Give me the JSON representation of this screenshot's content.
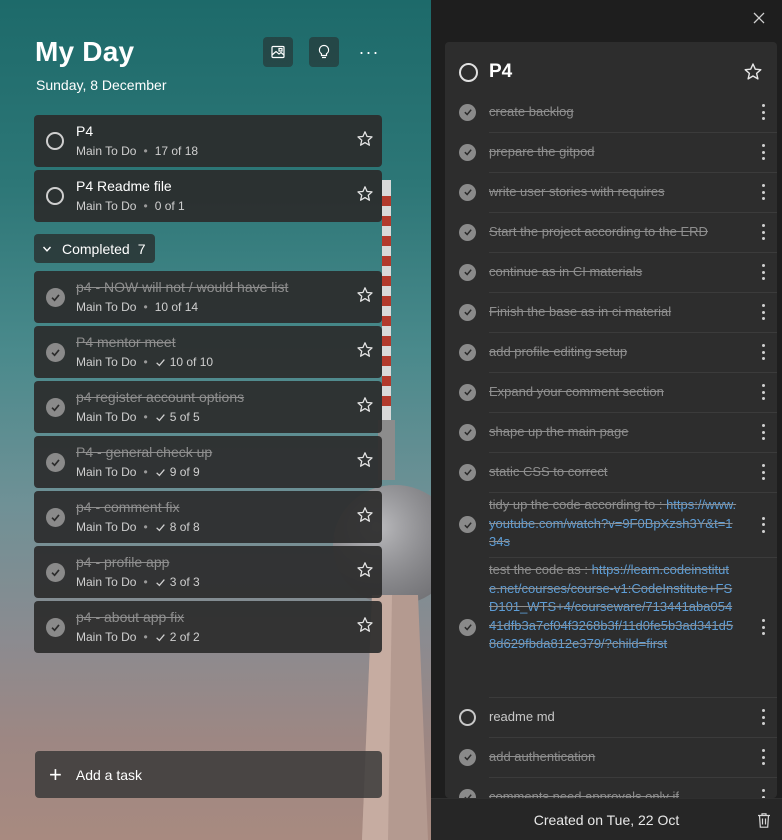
{
  "header": {
    "title": "My Day",
    "date": "Sunday, 8 December",
    "more_label": "···"
  },
  "tasks": [
    {
      "name": "P4",
      "list": "Main To Do",
      "steps": "17 of 18"
    },
    {
      "name": "P4 Readme file",
      "list": "Main To Do",
      "steps": "0 of 1"
    }
  ],
  "completed": {
    "label": "Completed",
    "count": "7",
    "items": [
      {
        "name": "p4 - NOW will not / would have list",
        "list": "Main To Do",
        "steps": "10 of 14"
      },
      {
        "name": "P4 mentor meet",
        "list": "Main To Do",
        "steps": "10 of 10"
      },
      {
        "name": "p4 register account options",
        "list": "Main To Do",
        "steps": "5 of 5"
      },
      {
        "name": "P4 - general check up",
        "list": "Main To Do",
        "steps": "9 of 9"
      },
      {
        "name": "p4 - comment fix",
        "list": "Main To Do",
        "steps": "8 of 8"
      },
      {
        "name": "p4 - profile app",
        "list": "Main To Do",
        "steps": "3 of 3"
      },
      {
        "name": "p4 - about app fix",
        "list": "Main To Do",
        "steps": "2 of 2"
      }
    ]
  },
  "add_task": {
    "label": "Add a task"
  },
  "detail": {
    "title": "P4",
    "steps": [
      {
        "text": "create backlog",
        "done": true
      },
      {
        "text": "prepare the gitpod",
        "done": true
      },
      {
        "text": "write user stories with requires",
        "done": true
      },
      {
        "text": "Start the project according to the ERD",
        "done": true
      },
      {
        "text": "continue as in CI materials",
        "done": true
      },
      {
        "text": "Finish the base as in ci material",
        "done": true
      },
      {
        "text": "add profile editing setup",
        "done": true
      },
      {
        "text": "Expand your comment section",
        "done": true
      },
      {
        "text": "shape up the main page",
        "done": true
      },
      {
        "text": "static CSS to correct",
        "done": true
      },
      {
        "text": "tidy up the code according to : ",
        "link": "https://www.youtube.com/watch?v=9F0BpXzsh3Y&t=134s",
        "done": true
      },
      {
        "text": "test the code as : ",
        "link": "https://learn.codeinstitute.net/courses/course-v1:CodeInstitute+FSD101_WTS+4/courseware/713441aba05441dfb3a7cf04f3268b3f/11d0fe5b3ad341d58d629fbda812e379/?child=first",
        "done": true
      },
      {
        "text": "readme md",
        "done": false
      },
      {
        "text": "add authentication",
        "done": true
      },
      {
        "text": "comments need approvals only if",
        "done": true
      }
    ],
    "created": "Created on Tue, 22 Oct"
  },
  "colors": {
    "accent_link": "#5d9ed8",
    "done_circle": "#8a8a8a",
    "panel": "#2d2d2d"
  }
}
